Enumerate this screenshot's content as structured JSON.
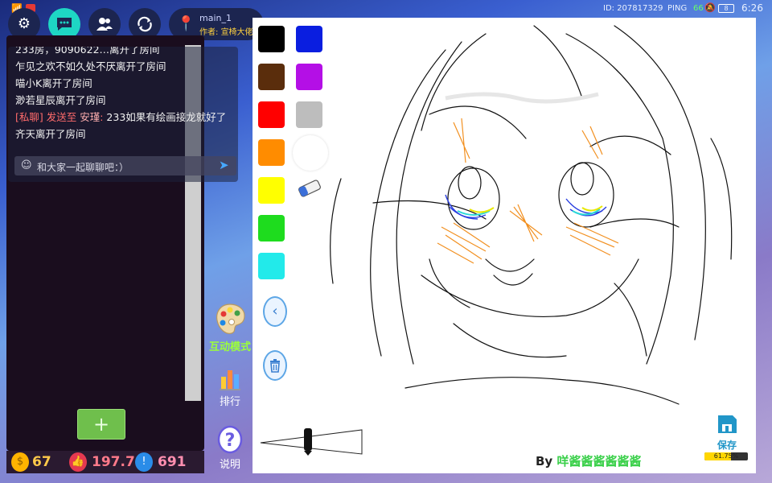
{
  "status_bar": {
    "id_text": "ID: 207817329",
    "ping_label": "PING",
    "ping_value": "66",
    "battery": "8",
    "time": "6:26"
  },
  "room": {
    "name": "main_1",
    "author_prefix": "作者: ",
    "author_name": "宣椅大佬"
  },
  "chat": {
    "lines": [
      "233房，9090622…离开了房间",
      "乍见之欢不如久处不厌离开了房间",
      "喵小K离开了房间",
      "渺若星辰离开了房间",
      "233如果有绘画接龙就好了",
      "齐天离开了房间"
    ],
    "private_tag": "[私聊]",
    "private_send_to": " 发送至 ",
    "private_target": "安瑾",
    "input_placeholder": "和大家一起聊聊吧：）",
    "plus_label": "+"
  },
  "stats": {
    "coins": "67",
    "likes": "197.7",
    "alerts": "691"
  },
  "tools": {
    "interactive_mode": "互动模式",
    "ranking": "排行",
    "help": "说明"
  },
  "canvas": {
    "palette": [
      "#000000",
      "#0a1ee0",
      "#5a2d0c",
      "#b40fe6",
      "#ff0000",
      "#bdbdbd",
      "#ff8c00",
      "#ffffff",
      "#ffff00",
      "#1edc1e",
      "#22eaea"
    ],
    "by_prefix": "By ",
    "by_name": "咩酱酱酱酱酱酱",
    "save_label": "保存",
    "progress_fraction": 0.6175,
    "progress_text": "61.75%"
  },
  "colors": {
    "accent_teal": "#1ed6c4",
    "dark_button": "#1c2550",
    "coin": "#ffb300",
    "like": "#e53950",
    "alert": "#2a8ce8",
    "green_button": "#6fbf4c"
  }
}
